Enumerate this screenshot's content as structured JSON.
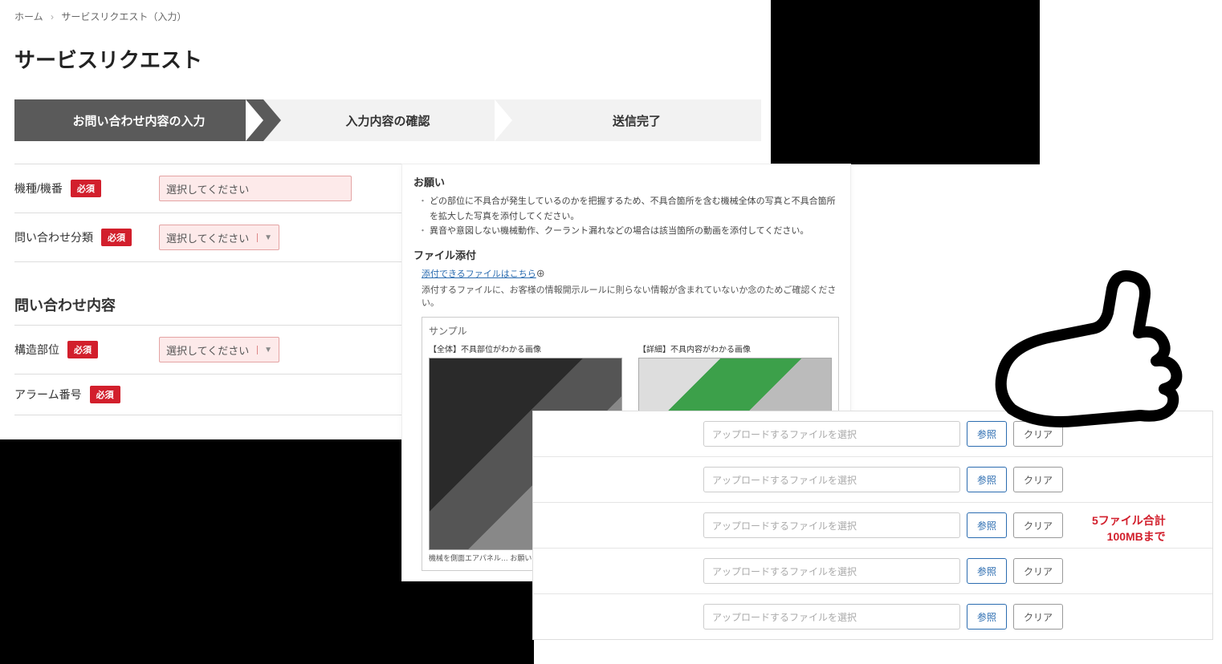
{
  "breadcrumb": {
    "home": "ホーム",
    "current": "サービスリクエスト（入力）"
  },
  "page_title": "サービスリクエスト",
  "stepper": {
    "step1": "お問い合わせ内容の入力",
    "step2": "入力内容の確認",
    "step3": "送信完了"
  },
  "required_label": "必須",
  "form": {
    "model_label": "機種/機番",
    "model_placeholder": "選択してください",
    "category_label": "問い合わせ分類",
    "category_placeholder": "選択してください",
    "content_section": "問い合わせ内容",
    "part_label": "構造部位",
    "part_placeholder": "選択してください",
    "alarm_label": "アラーム番号"
  },
  "mid_panel": {
    "request_title": "お願い",
    "request_item1": "どの部位に不具合が発生しているのかを把握するため、不具合箇所を含む機械全体の写真と不具合箇所を拡大した写真を添付してください。",
    "request_item2": "異音や意図しない機械動作、クーラント漏れなどの場合は該当箇所の動画を添付してください。",
    "attach_title": "ファイル添付",
    "attach_link": "添付できるファイルはこちら",
    "attach_note": "添付するファイルに、お客様の情報開示ルールに則らない情報が含まれていないか念のためご確認ください。",
    "sample_title": "サンプル",
    "sample_overall_label": "【全体】不具部位がわかる画像",
    "sample_detail_label": "【詳細】不具内容がわかる画像",
    "sample_caption": "機械を側面エアパネル…\nお願いいたします。"
  },
  "upload": {
    "placeholder": "アップロードするファイルを選択",
    "browse": "参照",
    "clear": "クリア"
  },
  "limit": {
    "line1": "5ファイル合計",
    "line2": "100MBまで"
  }
}
